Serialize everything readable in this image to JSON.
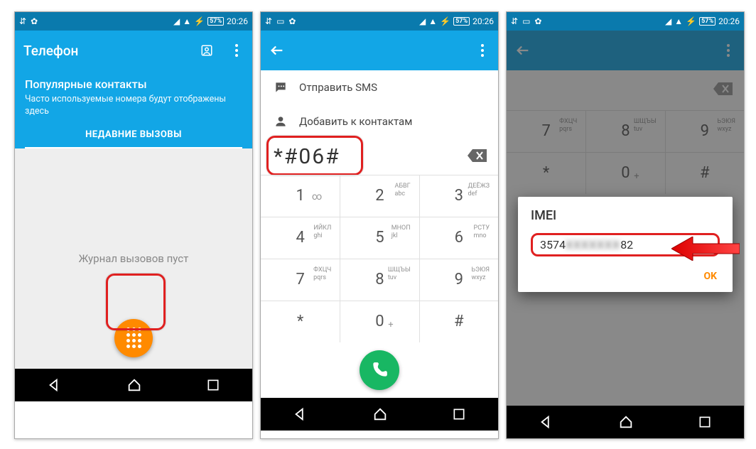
{
  "status": {
    "battery": "57%",
    "time": "20:26"
  },
  "screen1": {
    "title": "Телефон",
    "popular_heading": "Популярные контакты",
    "popular_sub": "Часто используемые номера будут отображены здесь",
    "recent_tab": "НЕДАВНИЕ ВЫЗОВЫ",
    "empty_log": "Журнал вызовов пуст"
  },
  "screen2": {
    "send_sms": "Отправить SMS",
    "add_contact": "Добавить к контактам",
    "entered": "*#06#",
    "keys": [
      {
        "d": "1",
        "sub_oo": "∞"
      },
      {
        "d": "2",
        "ru": "АБВГ",
        "en": "abc"
      },
      {
        "d": "3",
        "ru": "ДЕЁЖЗ",
        "en": "def"
      },
      {
        "d": "4",
        "ru": "ИЙКЛ",
        "en": "ghi"
      },
      {
        "d": "5",
        "ru": "МНОП",
        "en": "jkl"
      },
      {
        "d": "6",
        "ru": "РСТУ",
        "en": "mno"
      },
      {
        "d": "7",
        "ru": "ФХЦЧ",
        "en": "pqrs"
      },
      {
        "d": "8",
        "ru": "ШЩЪЫ",
        "en": "tuv"
      },
      {
        "d": "9",
        "ru": "ЬЭЮЯ",
        "en": "wxyz"
      },
      {
        "d": "*"
      },
      {
        "d": "0",
        "plus": "+"
      },
      {
        "d": "#"
      }
    ]
  },
  "screen3": {
    "dialog_title": "IMEI",
    "imei_prefix": "3574",
    "imei_blur": "XXXXXXX",
    "imei_suffix": "82",
    "ok": "OK"
  }
}
